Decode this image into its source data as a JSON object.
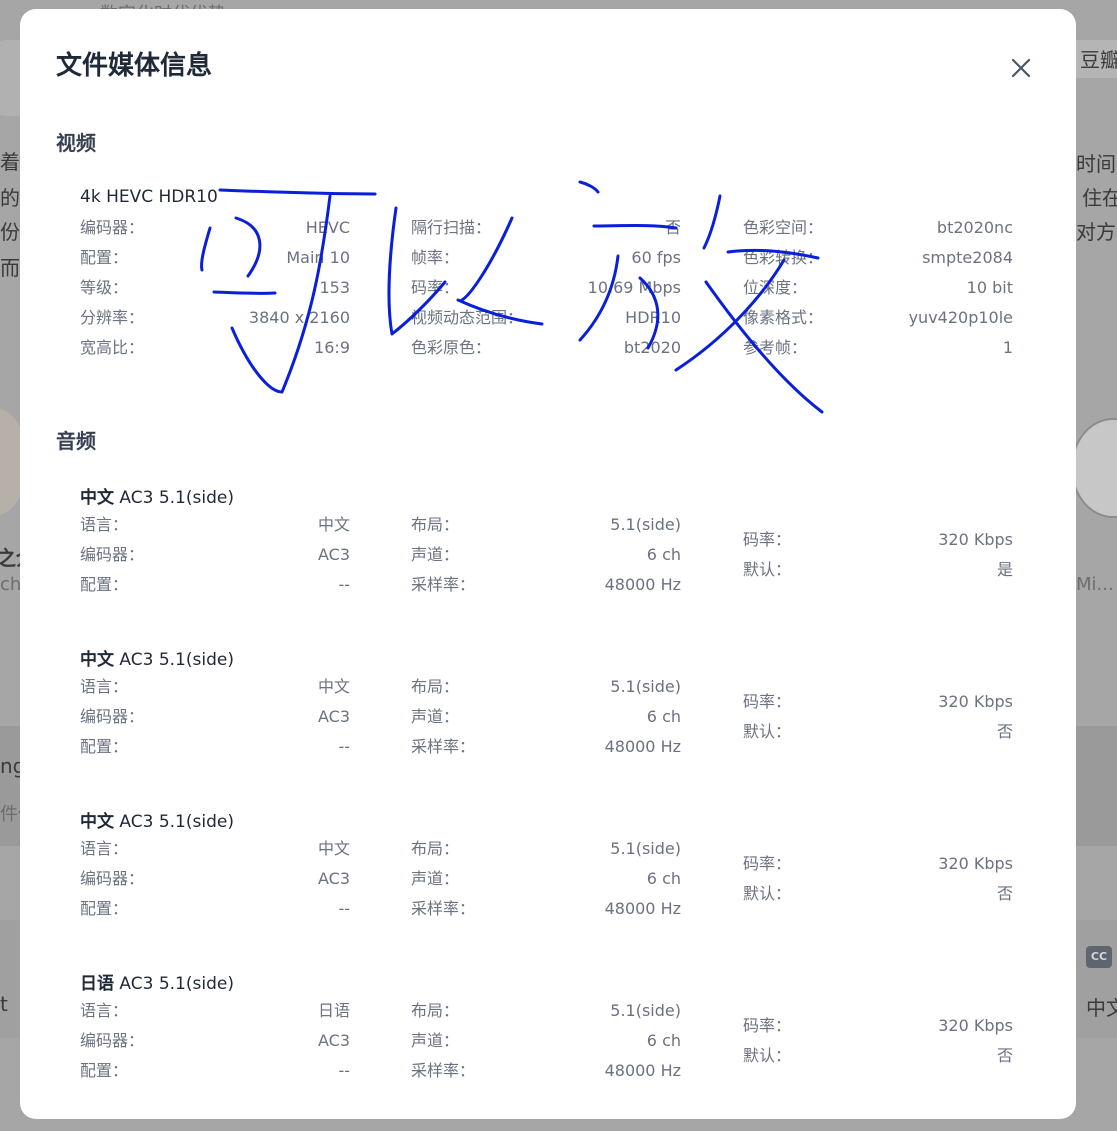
{
  "modal": {
    "title": "文件媒体信息",
    "close_icon": "close-icon"
  },
  "background": {
    "top_text": "数字化时代优势",
    "left_snippets": [
      "着",
      "的",
      "份",
      "而",
      "之介",
      "chi",
      "ng",
      "件任",
      "t"
    ],
    "right_snippets": [
      "豆瓣",
      "时间方",
      "住在",
      "对方的",
      "Mi...",
      "中文"
    ],
    "cc_label": "CC"
  },
  "video": {
    "section_label": "视频",
    "track_title": "4k HEVC HDR10",
    "columns": [
      [
        {
          "key": "编码器：",
          "value": "HEVC"
        },
        {
          "key": "配置：",
          "value": "Main 10"
        },
        {
          "key": "等级：",
          "value": "153"
        },
        {
          "key": "分辨率：",
          "value": "3840 x 2160"
        },
        {
          "key": "宽高比：",
          "value": "16:9"
        }
      ],
      [
        {
          "key": "隔行扫描：",
          "value": "否"
        },
        {
          "key": "帧率：",
          "value": "60 fps"
        },
        {
          "key": "码率：",
          "value": "10.69 Mbps"
        },
        {
          "key": "视频动态范围：",
          "value": "HDR10"
        },
        {
          "key": "色彩原色：",
          "value": "bt2020"
        }
      ],
      [
        {
          "key": "色彩空间：",
          "value": "bt2020nc"
        },
        {
          "key": "色彩转换：",
          "value": "smpte2084"
        },
        {
          "key": "位深度：",
          "value": "10 bit"
        },
        {
          "key": "像素格式：",
          "value": "yuv420p10le"
        },
        {
          "key": "参考帧：",
          "value": "1"
        }
      ]
    ]
  },
  "audio": {
    "section_label": "音频",
    "tracks": [
      {
        "lang_title": "中文",
        "title_rest": " AC3 5.1(side)",
        "col1": [
          {
            "key": "语言：",
            "value": "中文"
          },
          {
            "key": "编码器：",
            "value": "AC3"
          },
          {
            "key": "配置：",
            "value": "--"
          }
        ],
        "col2": [
          {
            "key": "布局：",
            "value": "5.1(side)"
          },
          {
            "key": "声道：",
            "value": "6 ch"
          },
          {
            "key": "采样率：",
            "value": "48000 Hz"
          }
        ],
        "col3": [
          {
            "key": "码率：",
            "value": "320 Kbps"
          },
          {
            "key": "默认：",
            "value": "是"
          }
        ]
      },
      {
        "lang_title": "中文",
        "title_rest": " AC3 5.1(side)",
        "col1": [
          {
            "key": "语言：",
            "value": "中文"
          },
          {
            "key": "编码器：",
            "value": "AC3"
          },
          {
            "key": "配置：",
            "value": "--"
          }
        ],
        "col2": [
          {
            "key": "布局：",
            "value": "5.1(side)"
          },
          {
            "key": "声道：",
            "value": "6 ch"
          },
          {
            "key": "采样率：",
            "value": "48000 Hz"
          }
        ],
        "col3": [
          {
            "key": "码率：",
            "value": "320 Kbps"
          },
          {
            "key": "默认：",
            "value": "否"
          }
        ]
      },
      {
        "lang_title": "中文",
        "title_rest": " AC3 5.1(side)",
        "col1": [
          {
            "key": "语言：",
            "value": "中文"
          },
          {
            "key": "编码器：",
            "value": "AC3"
          },
          {
            "key": "配置：",
            "value": "--"
          }
        ],
        "col2": [
          {
            "key": "布局：",
            "value": "5.1(side)"
          },
          {
            "key": "声道：",
            "value": "6 ch"
          },
          {
            "key": "采样率：",
            "value": "48000 Hz"
          }
        ],
        "col3": [
          {
            "key": "码率：",
            "value": "320 Kbps"
          },
          {
            "key": "默认：",
            "value": "否"
          }
        ]
      },
      {
        "lang_title": "日语",
        "title_rest": " AC3 5.1(side)",
        "col1": [
          {
            "key": "语言：",
            "value": "日语"
          },
          {
            "key": "编码器：",
            "value": "AC3"
          },
          {
            "key": "配置：",
            "value": "--"
          }
        ],
        "col2": [
          {
            "key": "布局：",
            "value": "5.1(side)"
          },
          {
            "key": "声道：",
            "value": "6 ch"
          },
          {
            "key": "采样率：",
            "value": "48000 Hz"
          }
        ],
        "col3": [
          {
            "key": "码率：",
            "value": "320 Kbps"
          },
          {
            "key": "默认：",
            "value": "否"
          }
        ]
      }
    ]
  },
  "annotation": {
    "handwriting": "可以放",
    "ink_color": "#0a1fd8"
  },
  "colors": {
    "title": "#1f2937",
    "label": "#6b7280",
    "overlay": "#a6a6a6"
  }
}
